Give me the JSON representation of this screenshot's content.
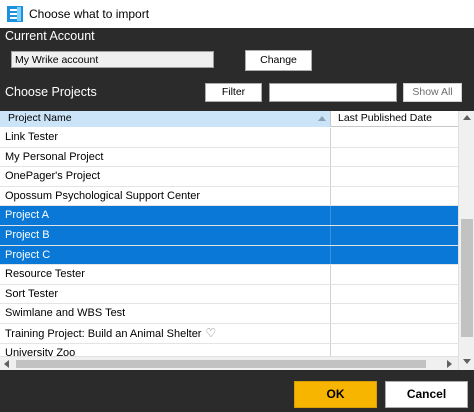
{
  "window": {
    "title": "Choose what to import"
  },
  "account": {
    "section_label": "Current Account",
    "value": "My Wrike account",
    "change_label": "Change"
  },
  "projects": {
    "section_label": "Choose Projects",
    "filter_label": "Filter",
    "filter_value": "",
    "show_all_label": "Show All"
  },
  "grid": {
    "columns": [
      "Project Name",
      "Last Published Date"
    ],
    "sort_icon": "sort-ascending-icon",
    "rows": [
      {
        "name": "Link Tester",
        "date": "",
        "selected": false
      },
      {
        "name": "My Personal Project",
        "date": "",
        "selected": false
      },
      {
        "name": "OnePager's Project",
        "date": "",
        "selected": false
      },
      {
        "name": "Opossum Psychological Support Center",
        "date": "",
        "selected": false
      },
      {
        "name": "Project A",
        "date": "",
        "selected": true
      },
      {
        "name": "Project B",
        "date": "",
        "selected": true
      },
      {
        "name": "Project C",
        "date": "",
        "selected": true
      },
      {
        "name": "Resource Tester",
        "date": "",
        "selected": false
      },
      {
        "name": "Sort Tester",
        "date": "",
        "selected": false
      },
      {
        "name": "Swimlane and WBS Test",
        "date": "",
        "selected": false
      },
      {
        "name": "Training Project: Build an Animal Shelter",
        "date": "",
        "selected": false,
        "icon": "heart-icon"
      },
      {
        "name": "University Zoo",
        "date": "",
        "selected": false
      }
    ]
  },
  "footer": {
    "ok_label": "OK",
    "cancel_label": "Cancel"
  },
  "colors": {
    "selection": "#0a78d7",
    "ok_button": "#f7b500",
    "panel": "#2b2b2b",
    "header_highlight": "#cce4f7"
  }
}
